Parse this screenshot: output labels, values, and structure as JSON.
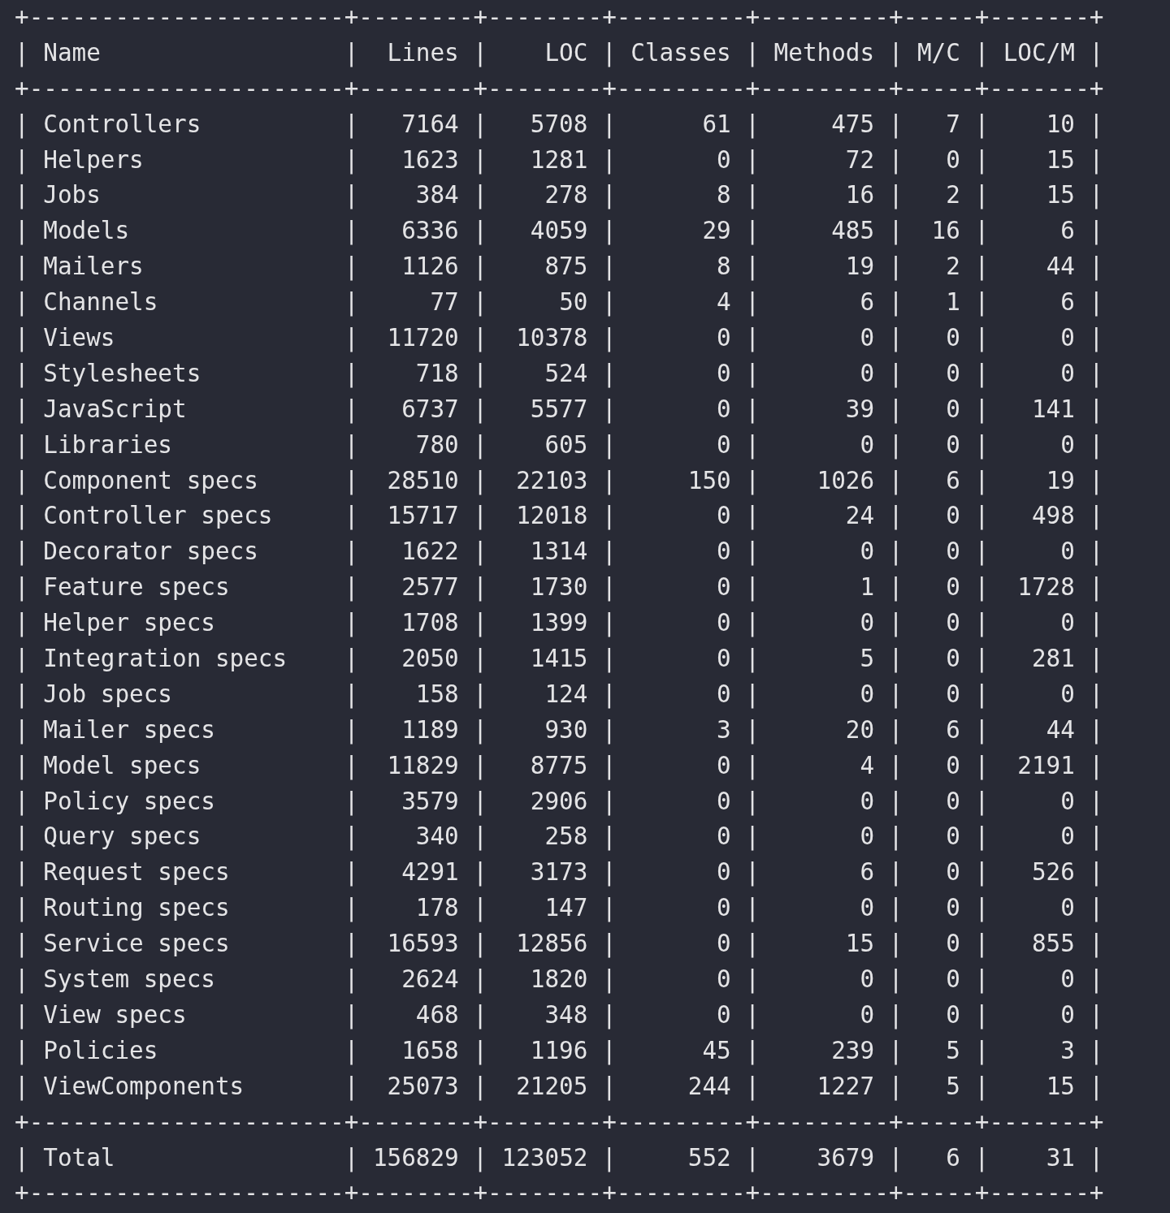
{
  "terminal": {
    "border_line": "+----------------------+--------+--------+---------+---------+-----+-------+",
    "column_separator": "|",
    "table": {
      "columns": [
        "Name",
        "Lines",
        "LOC",
        "Classes",
        "Methods",
        "M/C",
        "LOC/M"
      ],
      "rows": [
        [
          "Controllers",
          "7164",
          "5708",
          "61",
          "475",
          "7",
          "10"
        ],
        [
          "Helpers",
          "1623",
          "1281",
          "0",
          "72",
          "0",
          "15"
        ],
        [
          "Jobs",
          "384",
          "278",
          "8",
          "16",
          "2",
          "15"
        ],
        [
          "Models",
          "6336",
          "4059",
          "29",
          "485",
          "16",
          "6"
        ],
        [
          "Mailers",
          "1126",
          "875",
          "8",
          "19",
          "2",
          "44"
        ],
        [
          "Channels",
          "77",
          "50",
          "4",
          "6",
          "1",
          "6"
        ],
        [
          "Views",
          "11720",
          "10378",
          "0",
          "0",
          "0",
          "0"
        ],
        [
          "Stylesheets",
          "718",
          "524",
          "0",
          "0",
          "0",
          "0"
        ],
        [
          "JavaScript",
          "6737",
          "5577",
          "0",
          "39",
          "0",
          "141"
        ],
        [
          "Libraries",
          "780",
          "605",
          "0",
          "0",
          "0",
          "0"
        ],
        [
          "Component specs",
          "28510",
          "22103",
          "150",
          "1026",
          "6",
          "19"
        ],
        [
          "Controller specs",
          "15717",
          "12018",
          "0",
          "24",
          "0",
          "498"
        ],
        [
          "Decorator specs",
          "1622",
          "1314",
          "0",
          "0",
          "0",
          "0"
        ],
        [
          "Feature specs",
          "2577",
          "1730",
          "0",
          "1",
          "0",
          "1728"
        ],
        [
          "Helper specs",
          "1708",
          "1399",
          "0",
          "0",
          "0",
          "0"
        ],
        [
          "Integration specs",
          "2050",
          "1415",
          "0",
          "5",
          "0",
          "281"
        ],
        [
          "Job specs",
          "158",
          "124",
          "0",
          "0",
          "0",
          "0"
        ],
        [
          "Mailer specs",
          "1189",
          "930",
          "3",
          "20",
          "6",
          "44"
        ],
        [
          "Model specs",
          "11829",
          "8775",
          "0",
          "4",
          "0",
          "2191"
        ],
        [
          "Policy specs",
          "3579",
          "2906",
          "0",
          "0",
          "0",
          "0"
        ],
        [
          "Query specs",
          "340",
          "258",
          "0",
          "0",
          "0",
          "0"
        ],
        [
          "Request specs",
          "4291",
          "3173",
          "0",
          "6",
          "0",
          "526"
        ],
        [
          "Routing specs",
          "178",
          "147",
          "0",
          "0",
          "0",
          "0"
        ],
        [
          "Service specs",
          "16593",
          "12856",
          "0",
          "15",
          "0",
          "855"
        ],
        [
          "System specs",
          "2624",
          "1820",
          "0",
          "0",
          "0",
          "0"
        ],
        [
          "View specs",
          "468",
          "348",
          "0",
          "0",
          "0",
          "0"
        ],
        [
          "Policies",
          "1658",
          "1196",
          "45",
          "239",
          "5",
          "3"
        ],
        [
          "ViewComponents",
          "25073",
          "21205",
          "244",
          "1227",
          "5",
          "15"
        ]
      ],
      "total": [
        "Total",
        "156829",
        "123052",
        "552",
        "3679",
        "6",
        "31"
      ]
    }
  }
}
